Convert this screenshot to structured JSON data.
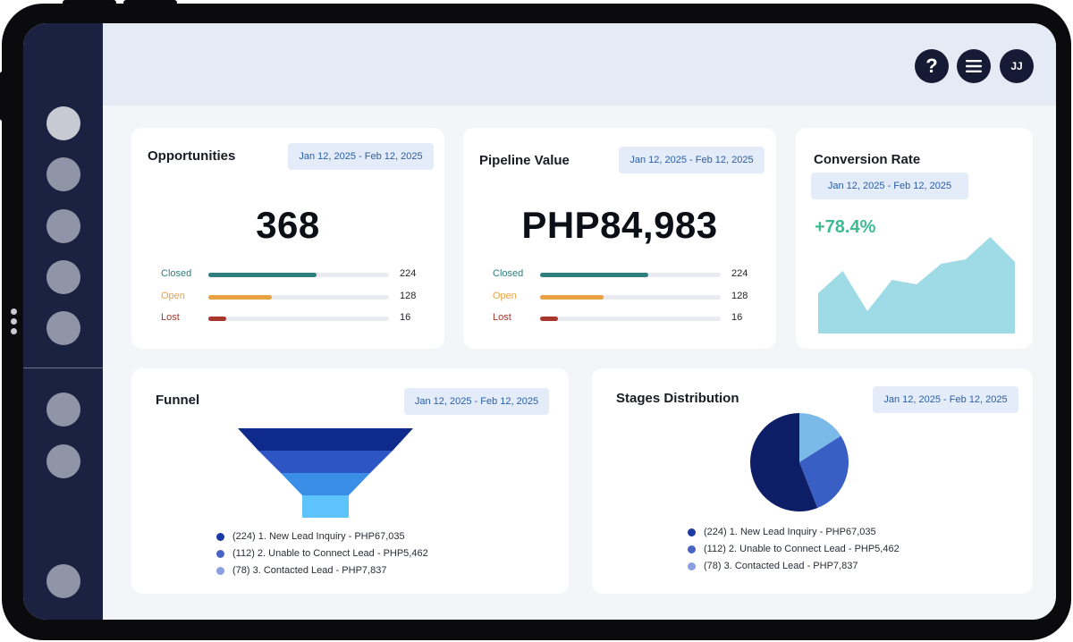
{
  "topbar": {
    "help_label": "?",
    "avatar_initials": "JJ"
  },
  "icons": {
    "help": "question-mark-icon",
    "menu": "hamburger-menu-icon"
  },
  "colors": {
    "sidebar": "#1b2140",
    "closed": "#2f7f7f",
    "open": "#e8a244",
    "lost": "#a8362c",
    "conversion": "#3dbb93",
    "date_pill_text": "#2b5ea8"
  },
  "opportunities": {
    "title": "Opportunities",
    "date_range": "Jan 12, 2025 - Feb 12, 2025",
    "total": "368",
    "rows": [
      {
        "label": "Closed",
        "value": "224",
        "fraction": 0.6
      },
      {
        "label": "Open",
        "value": "128",
        "fraction": 0.35
      },
      {
        "label": "Lost",
        "value": "16",
        "fraction": 0.1
      }
    ]
  },
  "pipeline": {
    "title": "Pipeline Value",
    "date_range": "Jan 12, 2025 - Feb 12, 2025",
    "total": "PHP84,983",
    "rows": [
      {
        "label": "Closed",
        "value": "224",
        "fraction": 0.6
      },
      {
        "label": "Open",
        "value": "128",
        "fraction": 0.35
      },
      {
        "label": "Lost",
        "value": "16",
        "fraction": 0.1
      }
    ]
  },
  "conversion": {
    "title": "Conversion Rate",
    "date_range": "Jan 12, 2025 - Feb 12, 2025",
    "value": "+78.4%",
    "trend": [
      45,
      70,
      25,
      60,
      55,
      78,
      83,
      108,
      80
    ]
  },
  "funnel": {
    "title": "Funnel",
    "date_range": "Jan 12, 2025 - Feb 12, 2025",
    "stage_colors": [
      "#0e2a8a",
      "#2e55c4",
      "#3a8ee6",
      "#5cc4fa"
    ],
    "legend": [
      {
        "text": "(224) 1. New Lead Inquiry - PHP67,035",
        "color": "#1c3aa3"
      },
      {
        "text": "(112) 2. Unable to Connect Lead - PHP5,462",
        "color": "#4a64c4"
      },
      {
        "text": "(78) 3. Contacted Lead - PHP7,837",
        "color": "#8a9ee0"
      }
    ]
  },
  "stages": {
    "title": "Stages Distribution",
    "date_range": "Jan 12, 2025 - Feb 12, 2025",
    "pie": [
      {
        "value": 56,
        "color": "#0d1d66"
      },
      {
        "value": 28,
        "color": "#3a5fc4"
      },
      {
        "value": 16,
        "color": "#7bb9e8"
      }
    ],
    "legend": [
      {
        "text": "(224) 1. New Lead Inquiry - PHP67,035",
        "color": "#1c3aa3"
      },
      {
        "text": "(112) 2. Unable to Connect Lead - PHP5,462",
        "color": "#4a64c4"
      },
      {
        "text": "(78) 3. Contacted Lead - PHP7,837",
        "color": "#8a9ee0"
      }
    ]
  }
}
